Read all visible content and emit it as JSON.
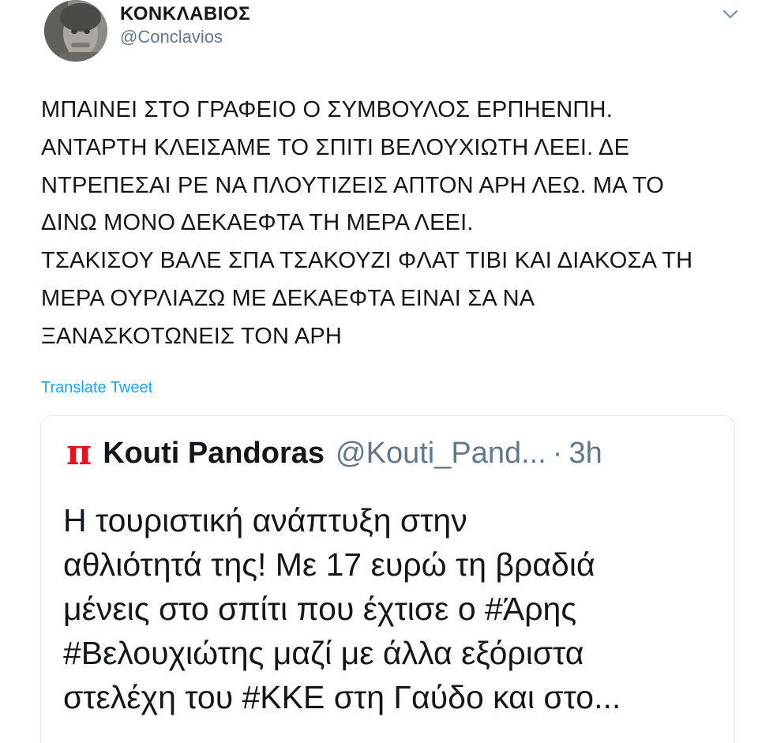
{
  "author": {
    "display_name": "ΚΟΝΚΛΑΒΙΟΣ",
    "handle": "@Conclavios"
  },
  "tweet": {
    "lines": [
      "ΜΠΑΙΝΕΙ ΣΤΟ ΓΡΑΦΕΙΟ Ο ΣΥΜΒΟΥΛΟΣ ΕΡΠΗΕΝΠΗ.",
      "ΑΝΤΑΡΤΗ ΚΛΕΙΣΑΜΕ ΤΟ ΣΠΙΤΙ ΒΕΛΟΥΧΙΩΤΗ ΛΕΕΙ. ΔΕ",
      "ΝΤΡΕΠΕΣΑΙ ΡΕ ΝΑ ΠΛΟΥΤΙΖΕΙΣ ΑΠΤΟΝ ΑΡΗ ΛΕΩ. ΜΑ ΤΟ",
      "ΔΙΝΩ ΜΟΝΟ ΔΕΚΑΕΦΤΑ ΤΗ ΜΕΡΑ ΛΕΕΙ.",
      "ΤΣΑΚΙΣΟΥ ΒΑΛΕ ΣΠΑ ΤΣΑΚΟΥΖΙ ΦΛΑΤ ΤΙΒΙ ΚΑΙ ΔΙΑΚΟΣΑ ΤΗ",
      "ΜΕΡΑ ΟΥΡΛΙΑΖΩ ΜΕ ΔΕΚΑΕΦΤΑ ΕΙΝΑΙ ΣΑ ΝΑ",
      "ΞΑΝΑΣΚΟΤΩΝΕΙΣ ΤΟΝ ΑΡΗ"
    ],
    "translate_label": "Translate Tweet"
  },
  "quote": {
    "logo_glyph": "π",
    "name": "Kouti Pandoras",
    "handle": "@Kouti_Pand...",
    "separator": "·",
    "time": "3h",
    "lines": [
      "Η τουριστική ανάπτυξη στην",
      "αθλιότητά της! Με 17 ευρώ τη βραδιά",
      "μένεις στο σπίτι που έχτισε ο #Άρης",
      "#Βελουχιώτης μαζί με άλλα εξόριστα",
      "στελέχη του #ΚΚΕ στη Γαύδο και στο..."
    ]
  },
  "icons": {
    "avatar": "avatar-photo",
    "menu": "chevron-down-icon",
    "quote_logo": "pi-logo"
  },
  "colors": {
    "link": "#1da1f2",
    "secondary_text": "#657786",
    "logo_red": "#e0141e",
    "border": "#e1e8ed"
  }
}
